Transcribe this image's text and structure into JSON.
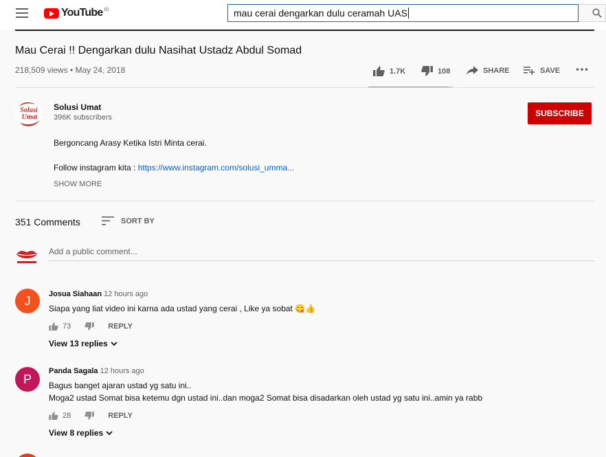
{
  "header": {
    "logo_text": "YouTube",
    "logo_region": "ID",
    "search_value": "mau cerai dengarkan dulu ceramah UAS"
  },
  "video": {
    "title": "Mau Cerai !! Dengarkan dulu Nasihat Ustadz Abdul Somad",
    "views_date": "218,509 views • May 24, 2018",
    "likes": "1.7K",
    "dislikes": "108",
    "like_ratio": 0.94,
    "share_label": "SHARE",
    "save_label": "SAVE"
  },
  "channel": {
    "name": "Solusi Umat",
    "subscribers": "396K subscribers",
    "subscribe_label": "SUBSCRIBE",
    "logo_line1": "Solusi",
    "logo_line2": "Umat",
    "description_line1": "Bergoncang Arasy Ketika Istri Minta cerai.",
    "description_line2_prefix": "Follow instagram kita : ",
    "description_link": "https://www.instagram.com/solusi_umma...",
    "show_more": "SHOW MORE"
  },
  "comments_header": {
    "count": "351 Comments",
    "sort_label": "SORT BY",
    "placeholder": "Add a public comment..."
  },
  "comments": [
    {
      "initial": "J",
      "avatar_color": "#f4511e",
      "author": "Josua Siahaan",
      "time": "12 hours ago",
      "lines": [
        "Siapa yang liat video ini karna ada ustad yang cerai , Like ya sobat 😋👍"
      ],
      "likes": "73",
      "reply_label": "REPLY",
      "view_replies": "View 13 replies"
    },
    {
      "initial": "P",
      "avatar_color": "#c2185b",
      "author": "Panda Sagala",
      "time": "12 hours ago",
      "lines": [
        "Bagus banget ajaran ustad yg satu ini..",
        "Moga2 ustad Somat bisa ketemu dgn ustad ini..dan moga2 Somat bisa disadarkan oleh ustad yg satu ini..amin ya rabb"
      ],
      "likes": "28",
      "reply_label": "REPLY",
      "view_replies": "View 8 replies"
    }
  ],
  "colors": {
    "subscribe": "#cc0000",
    "link": "#065fd4",
    "search_border": "#1c62b9"
  }
}
